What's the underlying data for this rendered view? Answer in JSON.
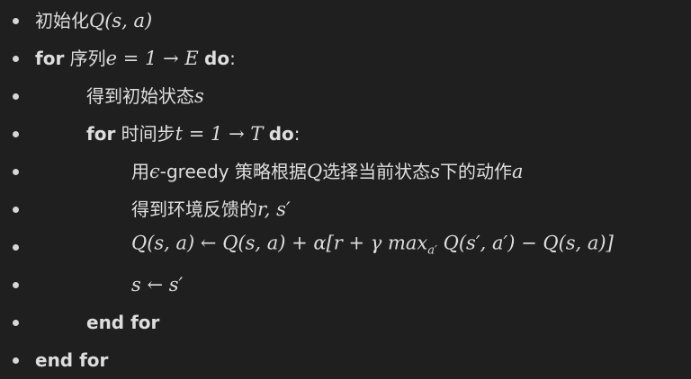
{
  "lines": [
    {
      "text_pre": "初始化",
      "math": "Q(s, a)"
    },
    {
      "kw1": "for",
      "text": "序列",
      "math": "e = 1 → E",
      "kw2": "do",
      "colon": ":"
    },
    {
      "text": "得到初始状态",
      "math": "s"
    },
    {
      "kw1": "for",
      "text": "时间步",
      "math": "t = 1 → T",
      "kw2": "do",
      "colon": ":"
    },
    {
      "t1": "用",
      "m1": "ϵ",
      "t2": "-greedy 策略根据",
      "m2": "Q",
      "t3": "选择当前状态",
      "m3": "s",
      "t4": "下的动作",
      "m4": "a"
    },
    {
      "text": "得到环境反馈的",
      "math": "r, s′"
    },
    {
      "math": "Q(s, a) ← Q(s, a) + α[r + γ max",
      "sub": "a′",
      "math2": " Q(s′, a′) − Q(s, a)]"
    },
    {
      "math": "s ← s′"
    },
    {
      "kw": "end for"
    },
    {
      "kw": "end for"
    }
  ]
}
